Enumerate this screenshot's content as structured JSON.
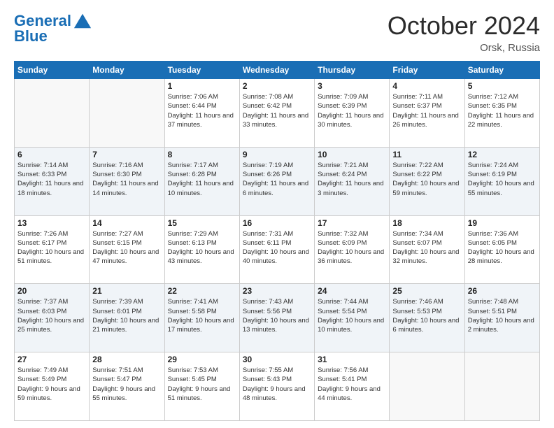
{
  "header": {
    "logo_line1": "General",
    "logo_line2": "Blue",
    "month": "October 2024",
    "location": "Orsk, Russia"
  },
  "weekdays": [
    "Sunday",
    "Monday",
    "Tuesday",
    "Wednesday",
    "Thursday",
    "Friday",
    "Saturday"
  ],
  "weeks": [
    [
      {
        "day": "",
        "info": ""
      },
      {
        "day": "",
        "info": ""
      },
      {
        "day": "1",
        "info": "Sunrise: 7:06 AM\nSunset: 6:44 PM\nDaylight: 11 hours and 37 minutes."
      },
      {
        "day": "2",
        "info": "Sunrise: 7:08 AM\nSunset: 6:42 PM\nDaylight: 11 hours and 33 minutes."
      },
      {
        "day": "3",
        "info": "Sunrise: 7:09 AM\nSunset: 6:39 PM\nDaylight: 11 hours and 30 minutes."
      },
      {
        "day": "4",
        "info": "Sunrise: 7:11 AM\nSunset: 6:37 PM\nDaylight: 11 hours and 26 minutes."
      },
      {
        "day": "5",
        "info": "Sunrise: 7:12 AM\nSunset: 6:35 PM\nDaylight: 11 hours and 22 minutes."
      }
    ],
    [
      {
        "day": "6",
        "info": "Sunrise: 7:14 AM\nSunset: 6:33 PM\nDaylight: 11 hours and 18 minutes."
      },
      {
        "day": "7",
        "info": "Sunrise: 7:16 AM\nSunset: 6:30 PM\nDaylight: 11 hours and 14 minutes."
      },
      {
        "day": "8",
        "info": "Sunrise: 7:17 AM\nSunset: 6:28 PM\nDaylight: 11 hours and 10 minutes."
      },
      {
        "day": "9",
        "info": "Sunrise: 7:19 AM\nSunset: 6:26 PM\nDaylight: 11 hours and 6 minutes."
      },
      {
        "day": "10",
        "info": "Sunrise: 7:21 AM\nSunset: 6:24 PM\nDaylight: 11 hours and 3 minutes."
      },
      {
        "day": "11",
        "info": "Sunrise: 7:22 AM\nSunset: 6:22 PM\nDaylight: 10 hours and 59 minutes."
      },
      {
        "day": "12",
        "info": "Sunrise: 7:24 AM\nSunset: 6:19 PM\nDaylight: 10 hours and 55 minutes."
      }
    ],
    [
      {
        "day": "13",
        "info": "Sunrise: 7:26 AM\nSunset: 6:17 PM\nDaylight: 10 hours and 51 minutes."
      },
      {
        "day": "14",
        "info": "Sunrise: 7:27 AM\nSunset: 6:15 PM\nDaylight: 10 hours and 47 minutes."
      },
      {
        "day": "15",
        "info": "Sunrise: 7:29 AM\nSunset: 6:13 PM\nDaylight: 10 hours and 43 minutes."
      },
      {
        "day": "16",
        "info": "Sunrise: 7:31 AM\nSunset: 6:11 PM\nDaylight: 10 hours and 40 minutes."
      },
      {
        "day": "17",
        "info": "Sunrise: 7:32 AM\nSunset: 6:09 PM\nDaylight: 10 hours and 36 minutes."
      },
      {
        "day": "18",
        "info": "Sunrise: 7:34 AM\nSunset: 6:07 PM\nDaylight: 10 hours and 32 minutes."
      },
      {
        "day": "19",
        "info": "Sunrise: 7:36 AM\nSunset: 6:05 PM\nDaylight: 10 hours and 28 minutes."
      }
    ],
    [
      {
        "day": "20",
        "info": "Sunrise: 7:37 AM\nSunset: 6:03 PM\nDaylight: 10 hours and 25 minutes."
      },
      {
        "day": "21",
        "info": "Sunrise: 7:39 AM\nSunset: 6:01 PM\nDaylight: 10 hours and 21 minutes."
      },
      {
        "day": "22",
        "info": "Sunrise: 7:41 AM\nSunset: 5:58 PM\nDaylight: 10 hours and 17 minutes."
      },
      {
        "day": "23",
        "info": "Sunrise: 7:43 AM\nSunset: 5:56 PM\nDaylight: 10 hours and 13 minutes."
      },
      {
        "day": "24",
        "info": "Sunrise: 7:44 AM\nSunset: 5:54 PM\nDaylight: 10 hours and 10 minutes."
      },
      {
        "day": "25",
        "info": "Sunrise: 7:46 AM\nSunset: 5:53 PM\nDaylight: 10 hours and 6 minutes."
      },
      {
        "day": "26",
        "info": "Sunrise: 7:48 AM\nSunset: 5:51 PM\nDaylight: 10 hours and 2 minutes."
      }
    ],
    [
      {
        "day": "27",
        "info": "Sunrise: 7:49 AM\nSunset: 5:49 PM\nDaylight: 9 hours and 59 minutes."
      },
      {
        "day": "28",
        "info": "Sunrise: 7:51 AM\nSunset: 5:47 PM\nDaylight: 9 hours and 55 minutes."
      },
      {
        "day": "29",
        "info": "Sunrise: 7:53 AM\nSunset: 5:45 PM\nDaylight: 9 hours and 51 minutes."
      },
      {
        "day": "30",
        "info": "Sunrise: 7:55 AM\nSunset: 5:43 PM\nDaylight: 9 hours and 48 minutes."
      },
      {
        "day": "31",
        "info": "Sunrise: 7:56 AM\nSunset: 5:41 PM\nDaylight: 9 hours and 44 minutes."
      },
      {
        "day": "",
        "info": ""
      },
      {
        "day": "",
        "info": ""
      }
    ]
  ]
}
